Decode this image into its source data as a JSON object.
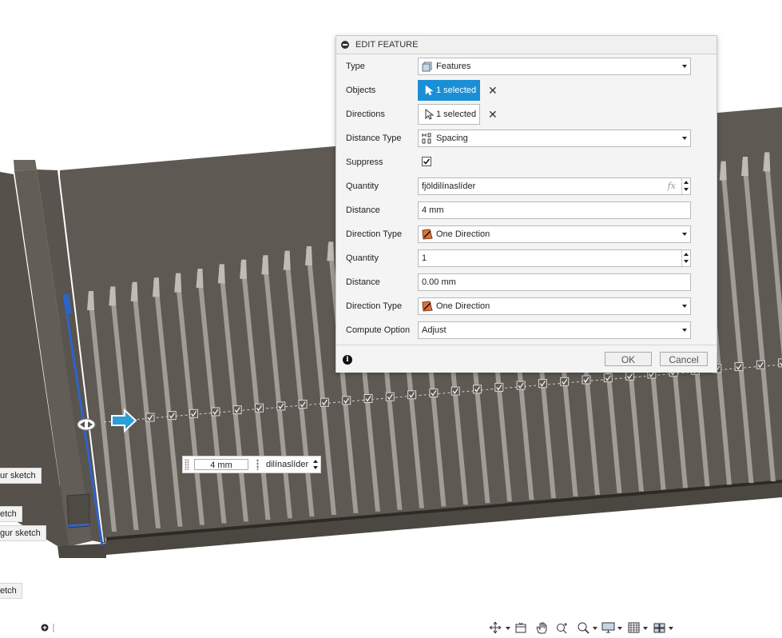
{
  "dialog": {
    "title": "EDIT FEATURE",
    "rows": {
      "type": {
        "label": "Type",
        "value": "Features"
      },
      "objects": {
        "label": "Objects",
        "value": "1 selected"
      },
      "directions": {
        "label": "Directions",
        "value": "1 selected"
      },
      "distance_type": {
        "label": "Distance Type",
        "value": "Spacing"
      },
      "suppress": {
        "label": "Suppress",
        "checked": true
      },
      "quantity1": {
        "label": "Quantity",
        "value": "fjöldilínaslíder",
        "fx": "fx"
      },
      "distance1": {
        "label": "Distance",
        "value": "4 mm"
      },
      "direction_type1": {
        "label": "Direction Type",
        "value": "One Direction"
      },
      "quantity2": {
        "label": "Quantity",
        "value": "1"
      },
      "distance2": {
        "label": "Distance",
        "value": "0.00 mm"
      },
      "direction_type2": {
        "label": "Direction Type",
        "value": "One Direction"
      },
      "compute_option": {
        "label": "Compute Option",
        "value": "Adjust"
      }
    },
    "ok_label": "OK",
    "cancel_label": "Cancel"
  },
  "manipulator": {
    "distance": "4 mm",
    "quantity": "dilínaslíder"
  },
  "browser_tags": [
    "ur sketch",
    "etch",
    "gur sketch",
    "etch"
  ],
  "colors": {
    "accent": "#1b8fd6",
    "model": "#5f5a52",
    "model_dark": "#4a4640",
    "slot": "#a7a39d"
  },
  "navbar_icons": [
    "orbit-icon",
    "look-at-icon",
    "pan-icon",
    "zoom-icon",
    "zoom-window-icon",
    "display-settings-icon",
    "grid-icon",
    "viewports-icon"
  ]
}
